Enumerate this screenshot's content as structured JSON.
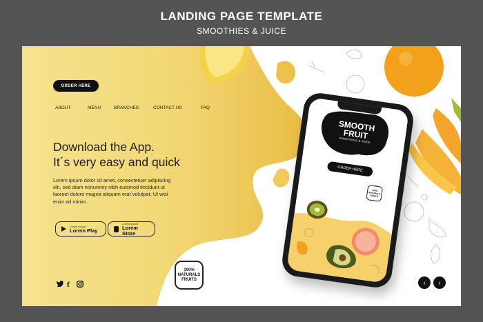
{
  "header": {
    "title": "LANDING PAGE TEMPLATE",
    "subtitle": "SMOOTHIES & JUICE"
  },
  "order_button": "ORDER HERE",
  "nav": {
    "items": [
      "ABOUT",
      "MENU",
      "BRANCHES",
      "CONTACT US",
      "FAQ"
    ]
  },
  "hero": {
    "line1": "Download the App.",
    "line2": "It´s very easy and quick"
  },
  "body_text": "Lorem ipsum dolor sit amet, consectetuer adipiscing elit, sed diam nonummy nibh euismod tincidunt ut laoreet dolore magna aliquam erat volutpat. Ut wisi enim ad minim.",
  "store_buttons": [
    {
      "small": "Lorem ipsum",
      "label": "Lorem Play",
      "icon": "play-icon"
    },
    {
      "small": "Lorem ipsum",
      "label": "Lorem Store",
      "icon": "apple-icon"
    }
  ],
  "social": {
    "twitter": "twitter-icon",
    "facebook": "facebook-icon",
    "instagram": "instagram-icon"
  },
  "badge": {
    "line1": "100%",
    "line2": "NATURALS",
    "line3": "FRUITS"
  },
  "phone": {
    "logo_line1": "SMOOTH",
    "logo_line2": "FRUIT",
    "logo_sub": "SMOOTHIES & JUICE",
    "button": "ORDER HERE",
    "badge_line1": "100%",
    "badge_line2": "NATURALS",
    "badge_line3": "FRUITS"
  },
  "arrows": {
    "prev": "‹",
    "next": "›"
  },
  "colors": {
    "background": "#545454",
    "yellow_light": "#f5df86",
    "yellow_dark": "#edc14c",
    "dark": "#111111"
  }
}
